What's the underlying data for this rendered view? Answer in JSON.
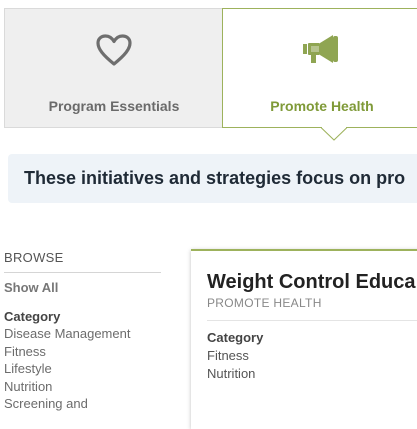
{
  "tabs": [
    {
      "label": "Program Essentials",
      "icon": "heart-icon",
      "active": false
    },
    {
      "label": "Promote Health",
      "icon": "megaphone-icon",
      "active": true
    }
  ],
  "banner": {
    "text": "These initiatives and strategies focus on pro"
  },
  "sidebar": {
    "title": "BROWSE",
    "show_all": "Show All",
    "category_heading": "Category",
    "categories": [
      "Disease Management",
      "Fitness",
      "Lifestyle",
      "Nutrition",
      "Screening and"
    ]
  },
  "card": {
    "title": "Weight Control Educa",
    "subtitle": "PROMOTE HEALTH",
    "category_heading": "Category",
    "categories": [
      "Fitness",
      "Nutrition"
    ]
  },
  "colors": {
    "accent_green": "#9db25c",
    "banner_bg": "#eef3f8",
    "inactive_tab_bg": "#efefef"
  }
}
